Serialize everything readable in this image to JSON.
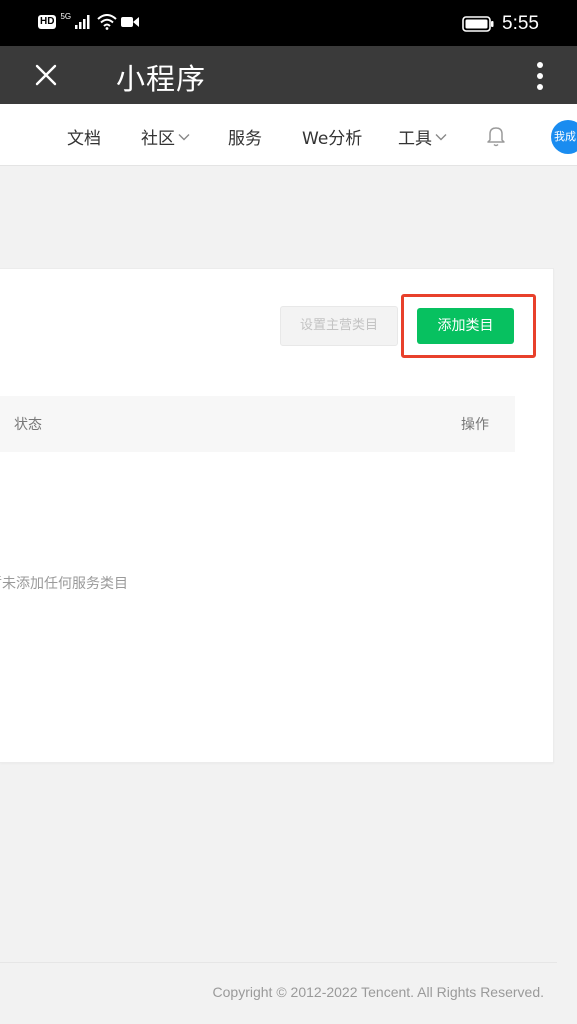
{
  "status_bar": {
    "hd_label": "HD",
    "network_label": "5G",
    "time": "5:55",
    "icons": [
      "hd-icon",
      "signal-icon",
      "wifi-icon",
      "video-icon",
      "battery-icon"
    ]
  },
  "title_bar": {
    "title": "小程序",
    "close_icon": "close-icon",
    "more_icon": "more-vertical-icon",
    "background": "#3a3a3a"
  },
  "nav": {
    "items": [
      {
        "label": "文档",
        "has_dropdown": false
      },
      {
        "label": "社区",
        "has_dropdown": true
      },
      {
        "label": "服务",
        "has_dropdown": false
      },
      {
        "label": "We分析",
        "has_dropdown": false
      },
      {
        "label": "工具",
        "has_dropdown": true
      }
    ],
    "bell_icon": "bell-icon",
    "avatar_text": "我成"
  },
  "card": {
    "set_main_category_label": "设置主营类目",
    "add_category_label": "添加类目",
    "table_headers": {
      "status": "状态",
      "action": "操作"
    },
    "empty_message": "暂未添加任何服务类目"
  },
  "footer": {
    "copyright": "Copyright © 2012-2022 Tencent. All Rights Reserved."
  },
  "colors": {
    "accent_green": "#07c160",
    "highlight_red": "#e8402b",
    "avatar_blue": "#1a8cf0"
  }
}
